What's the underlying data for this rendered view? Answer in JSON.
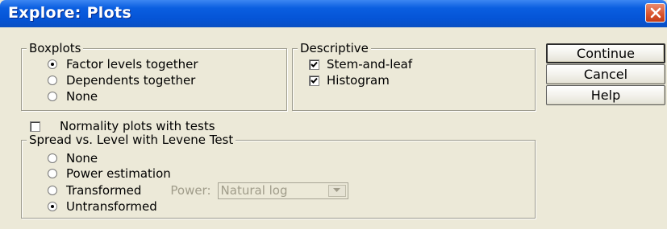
{
  "window": {
    "title": "Explore: Plots"
  },
  "boxplots": {
    "legend": "Boxplots",
    "options": [
      {
        "label": "Factor levels together",
        "checked": true
      },
      {
        "label": "Dependents together",
        "checked": false
      },
      {
        "label": "None",
        "checked": false
      }
    ]
  },
  "descriptive": {
    "legend": "Descriptive",
    "items": [
      {
        "label": "Stem-and-leaf",
        "checked": true
      },
      {
        "label": "Histogram",
        "checked": true
      }
    ]
  },
  "buttons": {
    "continue": "Continue",
    "cancel": "Cancel",
    "help": "Help"
  },
  "normality": {
    "label": "Normality plots with tests",
    "checked": false
  },
  "spread": {
    "legend": "Spread vs. Level with Levene Test",
    "options": [
      {
        "label": "None",
        "checked": false
      },
      {
        "label": "Power estimation",
        "checked": false
      },
      {
        "label": "Transformed",
        "checked": false
      },
      {
        "label": "Untransformed",
        "checked": true
      }
    ],
    "power_label": "Power:",
    "power_value": "Natural log"
  },
  "icons": {
    "close": "close-icon",
    "dropdown": "chevron-down-icon",
    "check": "checkmark-icon"
  },
  "colors": {
    "titlebar": "#0554d6",
    "dialog_bg": "#ece9d8",
    "close_button": "#d9532c"
  }
}
